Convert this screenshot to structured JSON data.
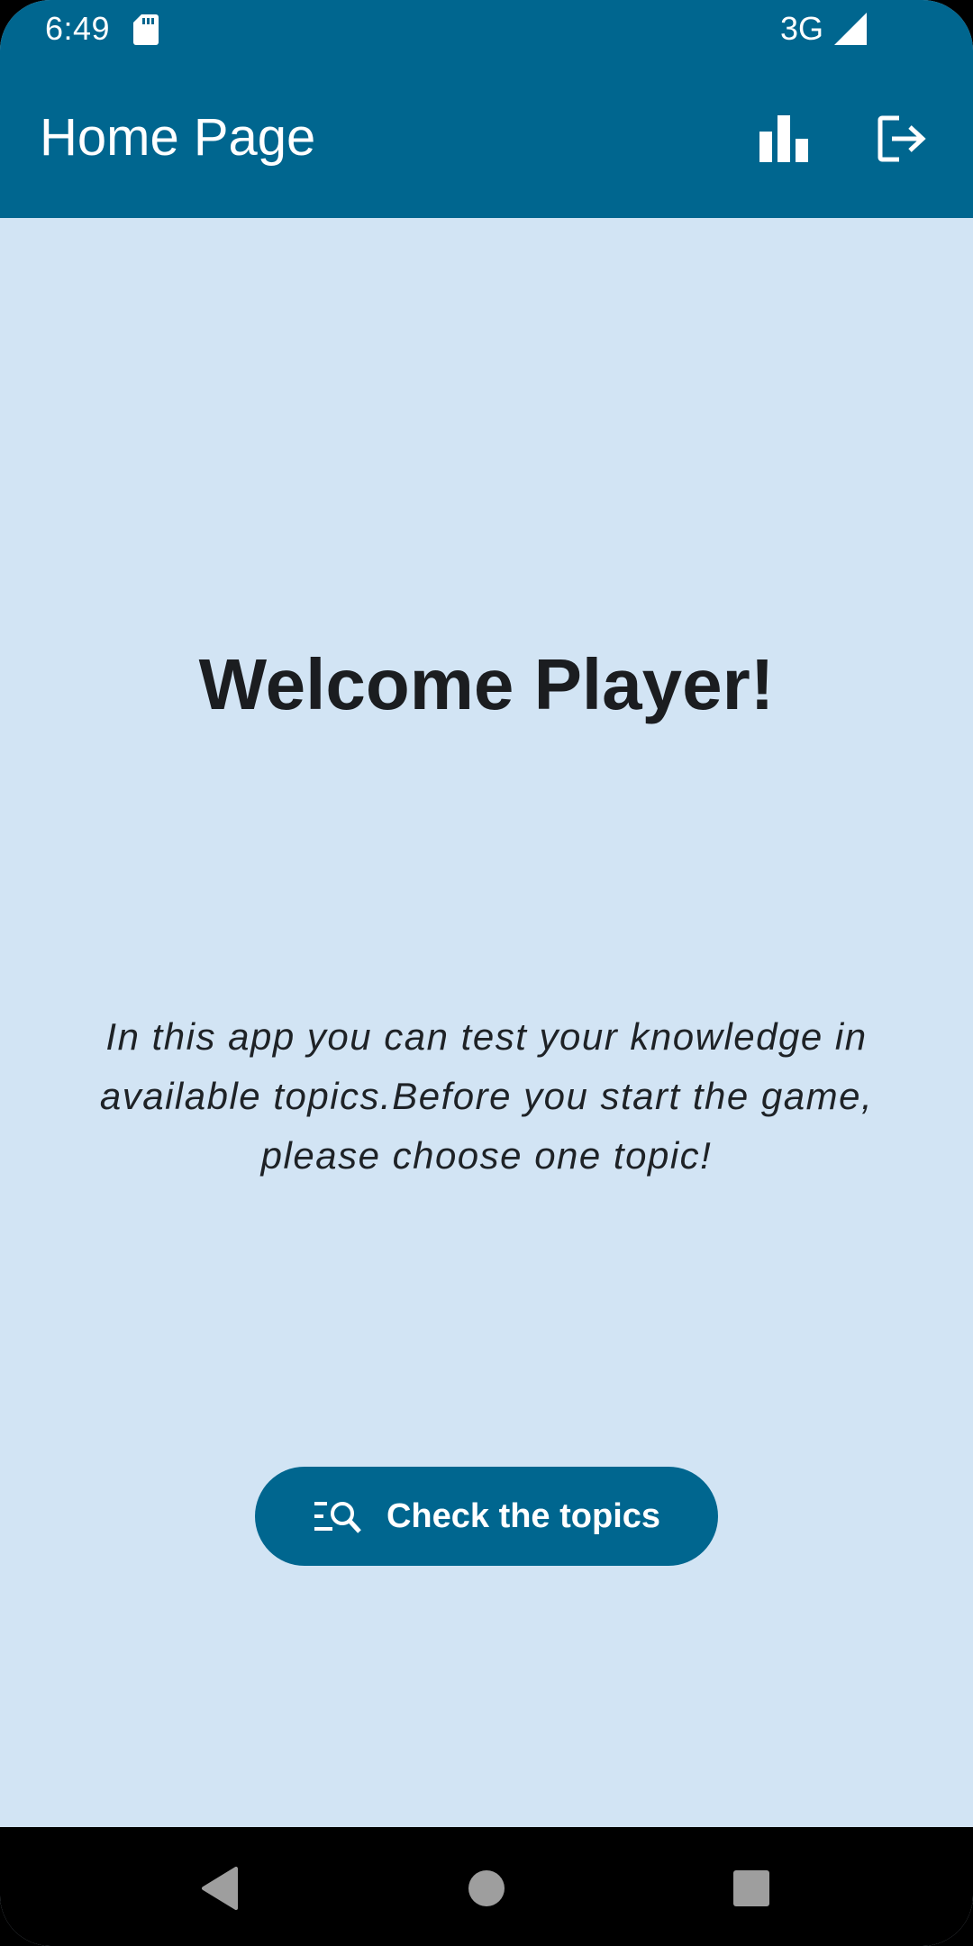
{
  "status_bar": {
    "time": "6:49",
    "network": "3G",
    "icons": [
      "sd-card-icon",
      "signal-icon"
    ]
  },
  "app_bar": {
    "title": "Home Page",
    "actions": [
      {
        "name": "statistics",
        "icon": "bar-chart-icon"
      },
      {
        "name": "logout",
        "icon": "logout-icon"
      }
    ]
  },
  "main": {
    "welcome_title": "Welcome Player!",
    "intro_text": "In this app you can test your knowledge in available topics.Before you start the game, please choose one topic!",
    "topics_button": {
      "label": "Check the topics",
      "icon": "list-search-icon"
    }
  },
  "nav_bar": {
    "buttons": [
      "back-icon",
      "home-icon",
      "recents-icon"
    ]
  },
  "colors": {
    "primary": "#00668f",
    "background": "#d2e4f4",
    "text_dark": "#1b1d20",
    "on_primary": "#ffffff",
    "nav_bar": "#000000"
  }
}
